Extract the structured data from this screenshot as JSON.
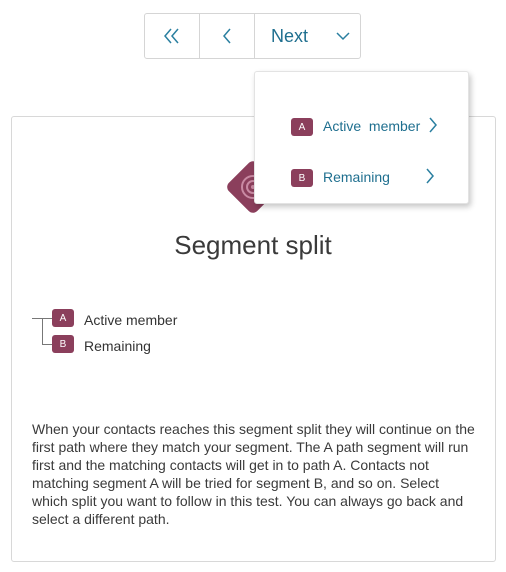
{
  "nav": {
    "next_label": "Next"
  },
  "card": {
    "title": "Segment split",
    "segments": [
      {
        "badge": "A",
        "label": "Active member"
      },
      {
        "badge": "B",
        "label": "Remaining"
      }
    ],
    "description": "When your contacts reaches this segment split they will continue on the first path where they match your segment. The A path segment will run first and the matching contacts will get in to path A. Contacts not matching segment A will be tried for segment B, and so on. Select which split you want to follow in this test. You can always go back and select a different path."
  },
  "dropdown": {
    "items": [
      {
        "badge": "A",
        "label": "Active  member"
      },
      {
        "badge": "B",
        "label": "Remaining"
      }
    ]
  },
  "colors": {
    "accent": "#1f6f8f",
    "badge": "#8b3f5c",
    "icon": "#8b3f5c"
  }
}
